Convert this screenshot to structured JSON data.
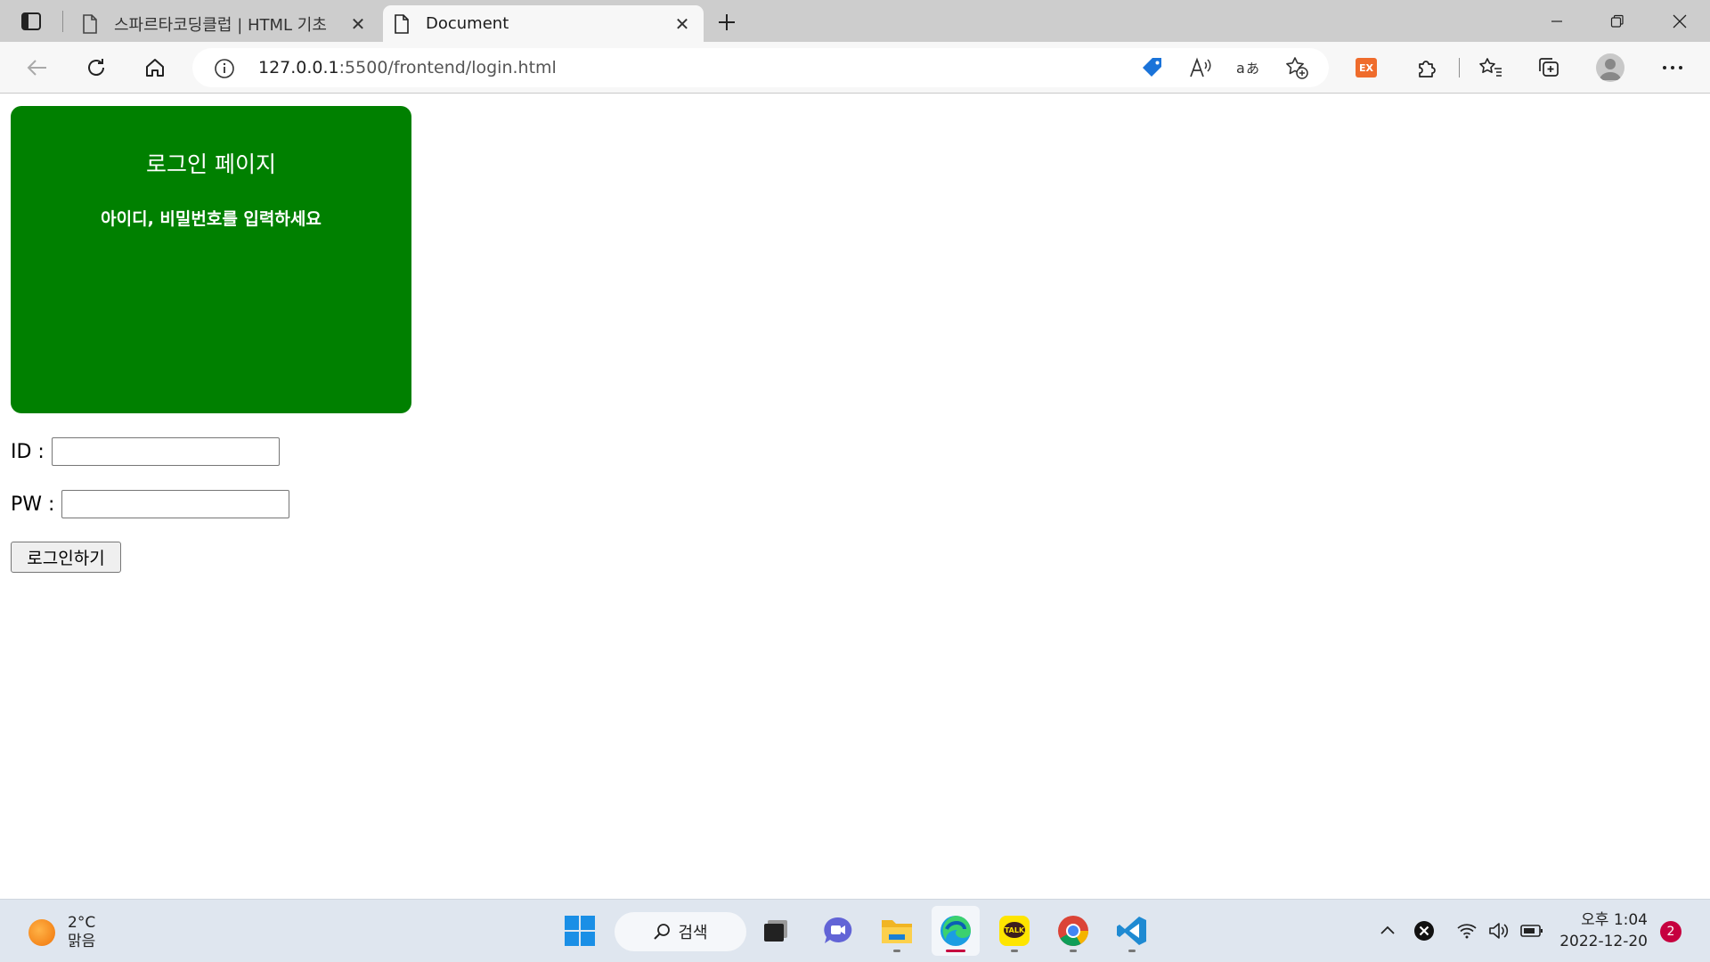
{
  "browser": {
    "tabs": [
      {
        "title": "스파르타코딩클럽 | HTML 기초",
        "active": false
      },
      {
        "title": "Document",
        "active": true
      }
    ],
    "address": {
      "host": "127.0.0.1",
      "path": ":5500/frontend/login.html"
    }
  },
  "page": {
    "heading": "로그인 페이지",
    "subheading": "아이디, 비밀번호를 입력하세요",
    "id_label": "ID :",
    "id_value": "",
    "pw_label": "PW :",
    "pw_value": "",
    "login_button": "로그인하기",
    "accent_color": "#008000"
  },
  "taskbar": {
    "weather_temp": "2°C",
    "weather_desc": "맑음",
    "search_label": "검색",
    "time": "오후 1:04",
    "date": "2022-12-20",
    "notification_count": "2"
  }
}
